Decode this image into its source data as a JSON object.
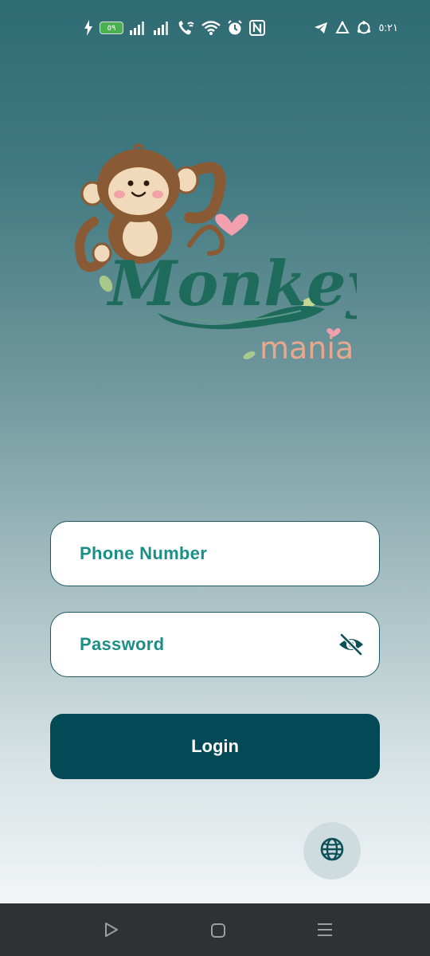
{
  "status_bar": {
    "battery_text": "٥٩",
    "time": "٥:٢١"
  },
  "logo": {
    "word_main": "Monkey",
    "word_sub": "mania",
    "colors": {
      "monkey_fur": "#8a5a34",
      "monkey_face": "#f1d9bb",
      "cheeks": "#f3a3a8",
      "heart": "#f2a0ad",
      "lettering": "#1f6b5b",
      "sub_lettering": "#e8a88f"
    }
  },
  "form": {
    "phone_label": "Phone Number",
    "password_label": "Password",
    "password_visibility_icon": "eye-off-icon",
    "login_label": "Login",
    "language_icon": "globe-icon"
  },
  "colors": {
    "accent_text": "#1b8f86",
    "button_bg": "#034a56",
    "field_border": "#1f5a63"
  },
  "nav_bar": {
    "back_icon": "triangle-back-icon",
    "home_icon": "square-home-icon",
    "menu_icon": "menu-lines-icon"
  }
}
